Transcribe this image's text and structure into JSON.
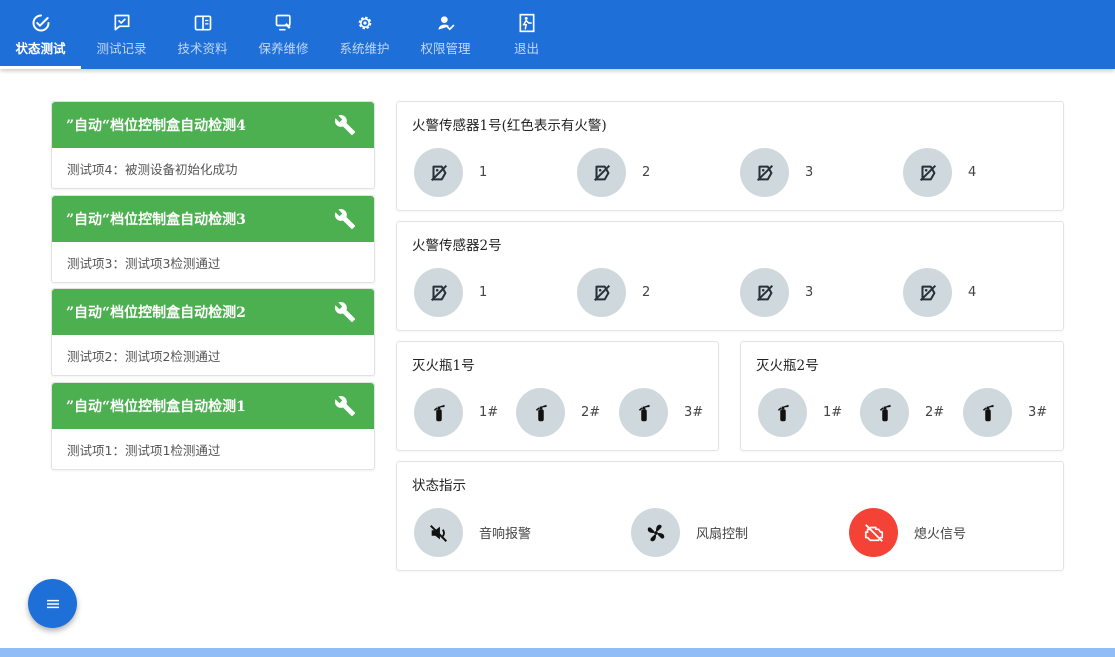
{
  "nav": [
    {
      "label": "状态测试",
      "icon": "check-gauge-icon",
      "active": true
    },
    {
      "label": "测试记录",
      "icon": "chat-check-icon"
    },
    {
      "label": "技术资料",
      "icon": "book-icon"
    },
    {
      "label": "保养维修",
      "icon": "wrench-screen-icon"
    },
    {
      "label": "系统维护",
      "icon": "gear-icon"
    },
    {
      "label": "权限管理",
      "icon": "user-check-icon"
    },
    {
      "label": "退出",
      "icon": "exit-icon"
    }
  ],
  "tasks": [
    {
      "title": "”自动“档位控制盒自动检测4",
      "detail": "测试项4：被测设备初始化成功"
    },
    {
      "title": "”自动“档位控制盒自动检测3",
      "detail": "测试项3：测试项3检测通过"
    },
    {
      "title": "”自动“档位控制盒自动检测2",
      "detail": "测试项2：测试项2检测通过"
    },
    {
      "title": "”自动“档位控制盒自动检测1",
      "detail": "测试项1：测试项1检测通过"
    }
  ],
  "fire_sensor_1": {
    "title": "火警传感器1号(红色表示有火警)",
    "items": [
      "1",
      "2",
      "3",
      "4"
    ]
  },
  "fire_sensor_2": {
    "title": "火警传感器2号",
    "items": [
      "1",
      "2",
      "3",
      "4"
    ]
  },
  "extinguisher_1": {
    "title": "灭火瓶1号",
    "items": [
      "1#",
      "2#",
      "3#"
    ]
  },
  "extinguisher_2": {
    "title": "灭火瓶2号",
    "items": [
      "1#",
      "2#",
      "3#"
    ]
  },
  "status": {
    "title": "状态指示",
    "items": [
      {
        "label": "音响报警",
        "icon": "volume-off-icon",
        "active": false
      },
      {
        "label": "风扇控制",
        "icon": "fan-icon",
        "active": false
      },
      {
        "label": "熄火信号",
        "icon": "engine-off-icon",
        "active": true
      }
    ]
  },
  "colors": {
    "primary": "#1e6fd8",
    "success": "#4caf50",
    "alert": "#f44336",
    "inactive": "#cfd8dc"
  }
}
